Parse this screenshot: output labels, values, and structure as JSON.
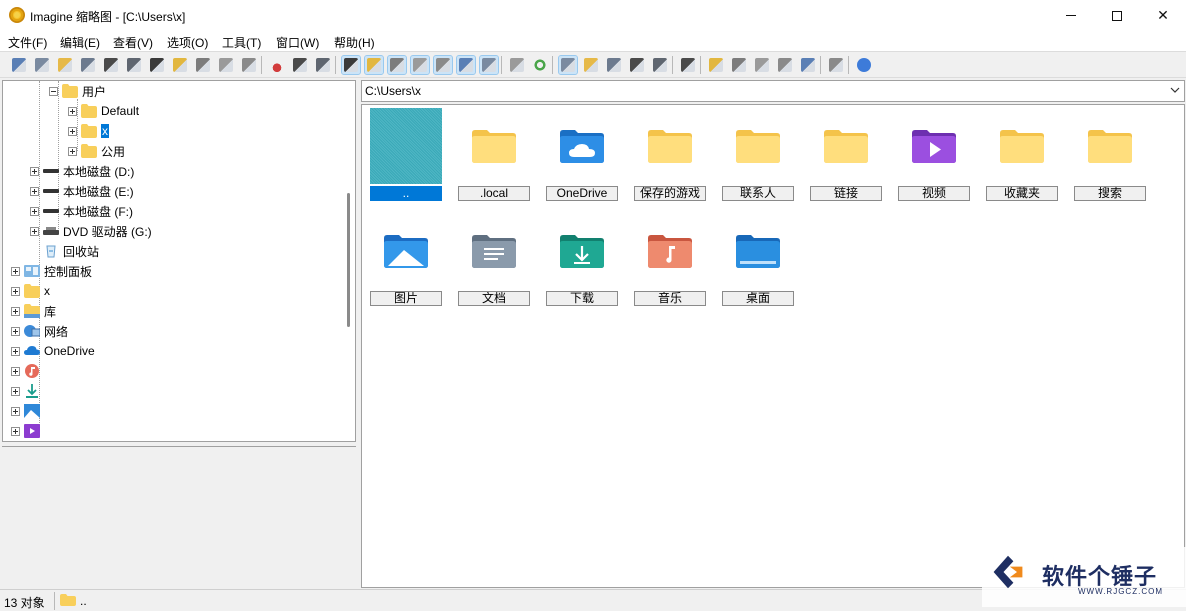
{
  "window": {
    "title": "Imagine 缩略图 - [C:\\Users\\x]"
  },
  "menu": [
    "文件(F)",
    "编辑(E)",
    "查看(V)",
    "选项(O)",
    "工具(T)",
    "窗口(W)",
    "帮助(H)"
  ],
  "toolbar_groups": [
    [
      "eye-icon",
      "slideshow-icon",
      "open-folder-icon",
      "copy-to-icon",
      "print-icon",
      "info-icon",
      "camera-icon",
      "new-folder-icon",
      "rename-icon",
      "delete-icon",
      "settings-icon"
    ],
    [
      "cut-icon",
      "copy-icon",
      "paste-icon"
    ],
    [
      "thumbnail-view-icon",
      "filmstrip-icon",
      "clock-icon",
      "detail-icon",
      "grid-icon",
      "single-icon",
      "photo-icon"
    ],
    [
      "folder-up-icon",
      "refresh-icon"
    ],
    [
      "large-icons-icon",
      "small-icons-icon",
      "list-icon",
      "details-icon",
      "tiles-icon"
    ],
    [
      "tools-icon"
    ],
    [
      "convert-icon",
      "batch-icon",
      "screen-capture-icon",
      "film-icon",
      "edit-icon"
    ],
    [
      "notes-icon"
    ],
    [
      "help-icon"
    ]
  ],
  "tree": [
    {
      "label": "用户",
      "expander": "minus",
      "type": "folder"
    },
    {
      "label": "Default",
      "expander": "plus",
      "type": "folder"
    },
    {
      "label": "x",
      "expander": "plus",
      "type": "folder",
      "selected": true
    },
    {
      "label": "公用",
      "expander": "plus",
      "type": "folder"
    },
    {
      "label": "本地磁盘 (D:)",
      "expander": "plus",
      "type": "drive"
    },
    {
      "label": "本地磁盘 (E:)",
      "expander": "plus",
      "type": "drive"
    },
    {
      "label": "本地磁盘 (F:)",
      "expander": "plus",
      "type": "drive"
    },
    {
      "label": "DVD 驱动器 (G:)",
      "expander": "plus",
      "type": "dvd"
    },
    {
      "label": "回收站",
      "expander": "none",
      "type": "recycle"
    },
    {
      "label": "控制面板",
      "expander": "plus",
      "type": "control"
    },
    {
      "label": "x",
      "expander": "plus",
      "type": "folder"
    },
    {
      "label": "库",
      "expander": "plus",
      "type": "library"
    },
    {
      "label": "网络",
      "expander": "plus",
      "type": "network"
    },
    {
      "label": "OneDrive",
      "expander": "plus",
      "type": "onedrive"
    },
    {
      "label": "",
      "expander": "plus",
      "type": "music"
    },
    {
      "label": "",
      "expander": "plus",
      "type": "download"
    },
    {
      "label": "",
      "expander": "plus",
      "type": "pictures"
    },
    {
      "label": "",
      "expander": "plus",
      "type": "video"
    }
  ],
  "address": {
    "path": "C:\\Users\\x"
  },
  "thumbnails": [
    {
      "label": "..",
      "kind": "parent",
      "selected": true
    },
    {
      "label": ".local",
      "kind": "folder"
    },
    {
      "label": "OneDrive",
      "kind": "onedrive"
    },
    {
      "label": "保存的游戏",
      "kind": "folder"
    },
    {
      "label": "联系人",
      "kind": "folder"
    },
    {
      "label": "链接",
      "kind": "folder"
    },
    {
      "label": "视频",
      "kind": "videos"
    },
    {
      "label": "收藏夹",
      "kind": "folder"
    },
    {
      "label": "搜索",
      "kind": "folder"
    },
    {
      "label": "图片",
      "kind": "pictures"
    },
    {
      "label": "文档",
      "kind": "documents"
    },
    {
      "label": "下载",
      "kind": "downloads"
    },
    {
      "label": "音乐",
      "kind": "music"
    },
    {
      "label": "桌面",
      "kind": "desktop"
    }
  ],
  "status": {
    "count": "13 对象",
    "path": ".."
  },
  "watermark": {
    "text": "软件个锤子",
    "sub": "WWW.RJGCZ.COM"
  },
  "colors": {
    "selection": "#0078d7",
    "folder": "#f8cf5b",
    "accent": "#1e2e62"
  }
}
